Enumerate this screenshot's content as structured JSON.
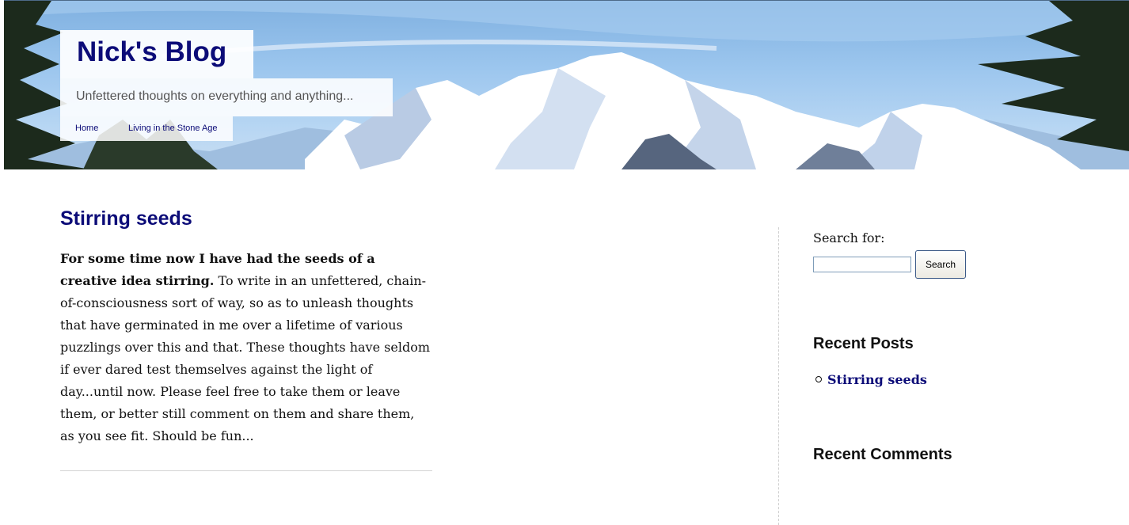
{
  "header": {
    "site_title": "Nick's Blog",
    "tagline": "Unfettered thoughts on everything and anything...",
    "nav": [
      {
        "label": "Home"
      },
      {
        "label": "Living in the Stone Age"
      }
    ]
  },
  "post": {
    "title": "Stirring seeds",
    "lead": "For some time now I have had the seeds of a creative idea stirring.",
    "body": "To write in an unfettered, chain-of-consciousness sort of way, so as to unleash thoughts that have germinated in me over a lifetime of various puzzlings over this and that. These thoughts have seldom if ever dared test themselves against the light of day...until now. Please feel free to take them or leave them, or better still comment on them and share them, as you see fit. Should be fun..."
  },
  "sidebar": {
    "search_label": "Search for:",
    "search_value": "",
    "search_button": "Search",
    "recent_posts_title": "Recent Posts",
    "recent_posts": [
      {
        "label": "Stirring seeds"
      }
    ],
    "recent_comments_title": "Recent Comments"
  },
  "colors": {
    "link": "#0c0c78",
    "sky": "#9cc6ee",
    "snow": "#ffffff",
    "tree": "#1c2a1c"
  },
  "icons": {
    "list_bullet": "circle-bullet-icon"
  }
}
